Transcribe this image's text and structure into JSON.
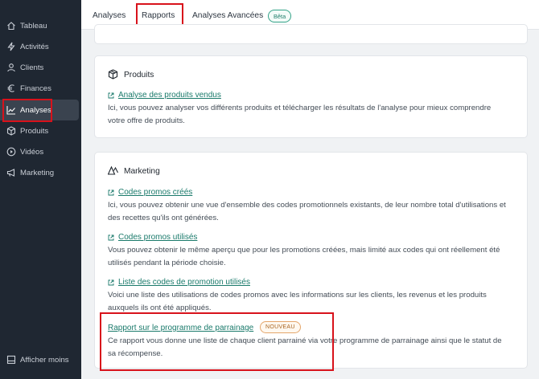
{
  "sidebar": {
    "items": [
      {
        "label": "Tableau",
        "icon": "home-icon"
      },
      {
        "label": "Activités",
        "icon": "bolt-icon"
      },
      {
        "label": "Clients",
        "icon": "user-icon"
      },
      {
        "label": "Finances",
        "icon": "euro-icon"
      },
      {
        "label": "Analyses",
        "icon": "chart-line-icon",
        "active": true
      },
      {
        "label": "Produits",
        "icon": "box-icon"
      },
      {
        "label": "Vidéos",
        "icon": "play-circle-icon"
      },
      {
        "label": "Marketing",
        "icon": "megaphone-icon"
      }
    ],
    "collapse_label": "Afficher moins"
  },
  "tabs": {
    "analyses": "Analyses",
    "rapports": "Rapports",
    "avancees": "Analyses Avancées",
    "beta_badge": "Bêta"
  },
  "produits": {
    "title": "Produits",
    "link": "Analyse des produits vendus",
    "desc": "Ici, vous pouvez analyser vos différents produits et télécharger les résultats de l'analyse pour mieux comprendre votre offre de produits."
  },
  "marketing": {
    "title": "Marketing",
    "reports": [
      {
        "link": "Codes promos créés",
        "desc": "Ici, vous pouvez obtenir une vue d'ensemble des codes promotionnels existants, de leur nombre total d'utilisations et des recettes qu'ils ont générées."
      },
      {
        "link": "Codes promos utilisés",
        "desc": "Vous pouvez obtenir le même aperçu que pour les promotions créées, mais limité aux codes qui ont réellement été utilisés pendant la période choisie."
      },
      {
        "link": "Liste des codes de promotion utilisés",
        "desc": "Voici une liste des utilisations de codes promos avec les informations sur les clients, les revenus et les produits auxquels ils ont été appliqués."
      },
      {
        "link": "Rapport sur le programme de parrainage",
        "badge": "NOUVEAU",
        "desc": "Ce rapport vous donne une liste de chaque client parrainé via votre programme de parrainage ainsi que le statut de sa récompense."
      }
    ]
  },
  "colors": {
    "accent": "#1e8a78",
    "highlight": "#d8121b",
    "sidebar": "#1f2732"
  }
}
